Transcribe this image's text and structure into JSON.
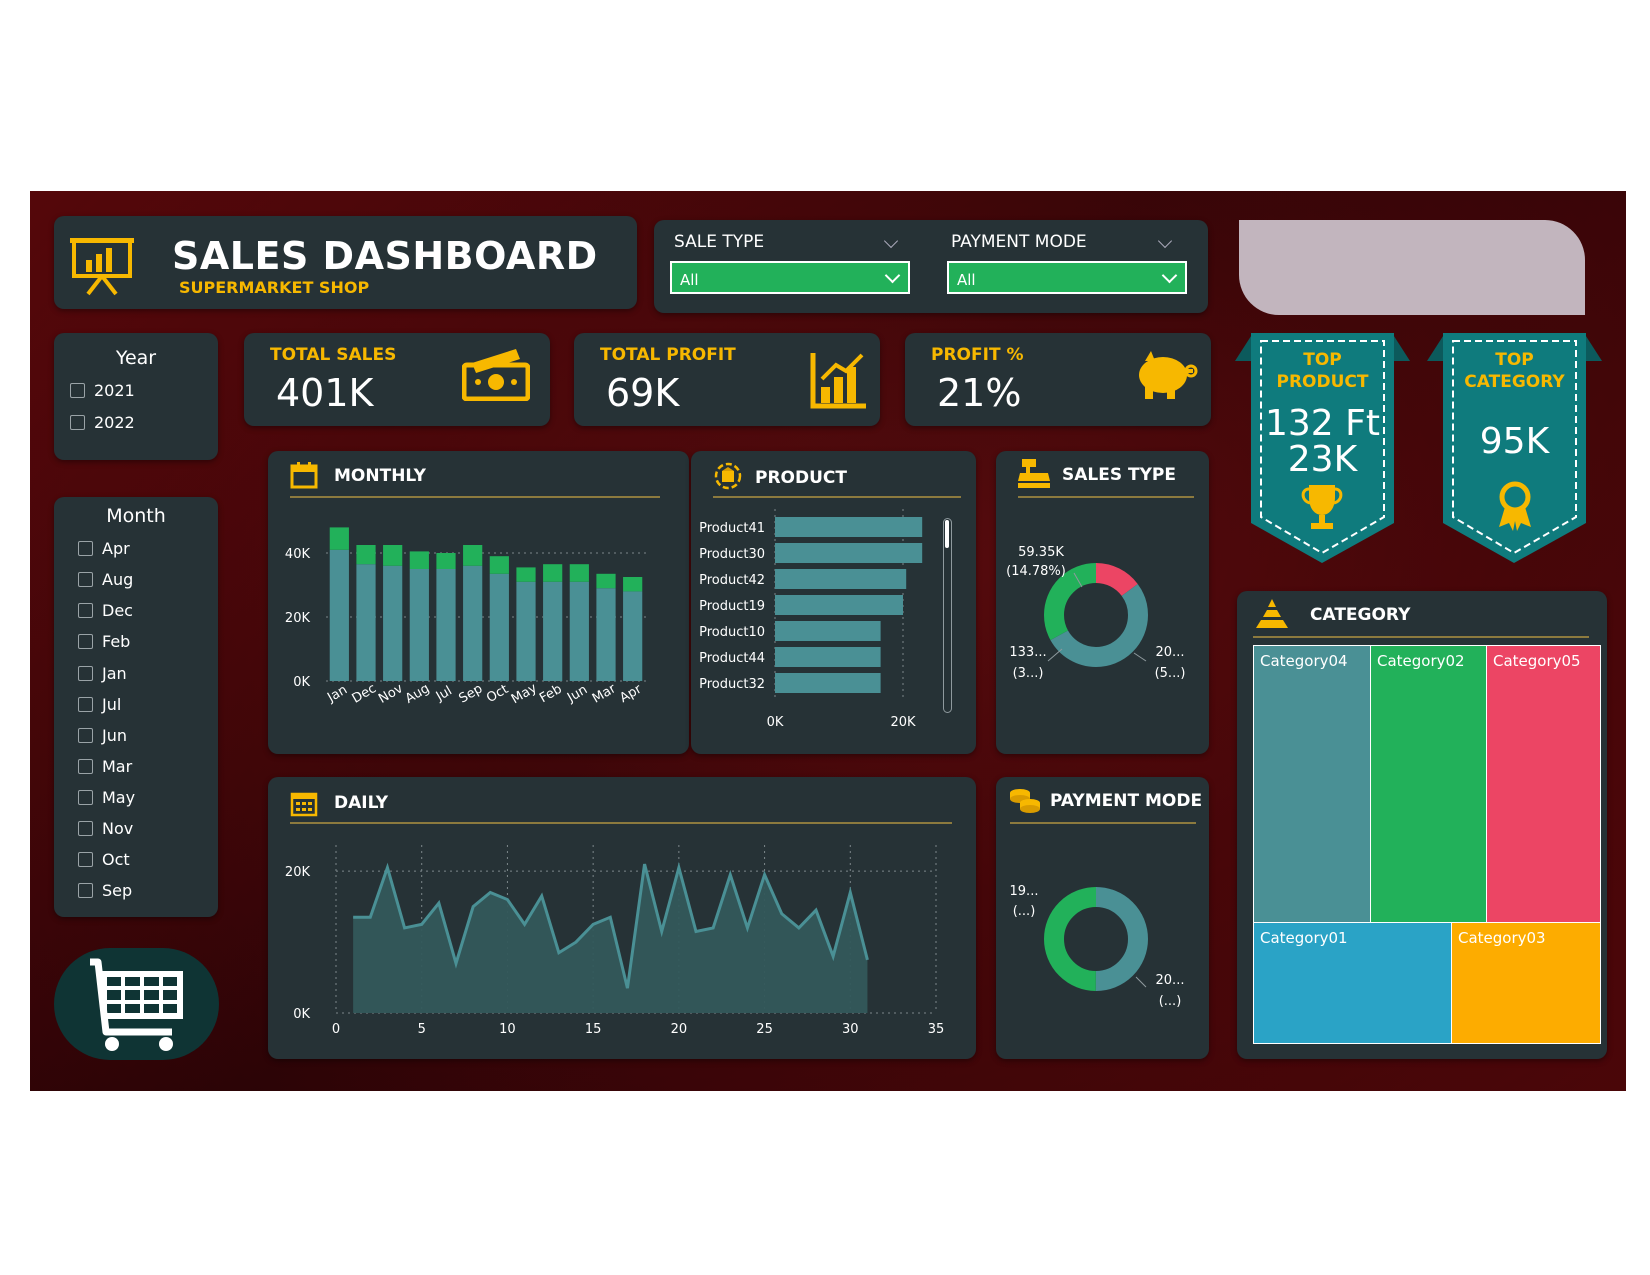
{
  "header": {
    "title": "SALES DASHBOARD",
    "subtitle": "SUPERMARKET SHOP"
  },
  "filters": {
    "sale_type": {
      "label": "SALE TYPE",
      "value": "All"
    },
    "payment_mode": {
      "label": "PAYMENT MODE",
      "value": "All"
    }
  },
  "year_slicer": {
    "title": "Year",
    "items": [
      "2021",
      "2022"
    ]
  },
  "month_slicer": {
    "title": "Month",
    "items": [
      "Apr",
      "Aug",
      "Dec",
      "Feb",
      "Jan",
      "Jul",
      "Jun",
      "Mar",
      "May",
      "Nov",
      "Oct",
      "Sep"
    ]
  },
  "kpis": {
    "total_sales": {
      "label": "TOTAL SALES",
      "value": "401K"
    },
    "total_profit": {
      "label": "TOTAL PROFIT",
      "value": "69K"
    },
    "profit_pct": {
      "label": "PROFIT %",
      "value": "21%"
    }
  },
  "top_product": {
    "line1": "TOP",
    "line2": "PRODUCT",
    "value1": "132 Ft",
    "value2": "23K"
  },
  "top_category": {
    "line1": "TOP",
    "line2": "CATEGORY",
    "value": "95K"
  },
  "sections": {
    "monthly": "MONTHLY",
    "product": "PRODUCT",
    "sales_type": "SALES TYPE",
    "daily": "DAILY",
    "payment_mode": "PAYMENT MODE",
    "category": "CATEGORY"
  },
  "colors": {
    "teal": "#4a9095",
    "green": "#22b15a",
    "red": "#ec4564",
    "blue": "#2aa3c6",
    "orange": "#fdac00",
    "yellow": "#f7b800"
  },
  "chart_data": [
    {
      "id": "monthly",
      "type": "bar",
      "categories": [
        "Jan",
        "Dec",
        "Nov",
        "Aug",
        "Jul",
        "Sep",
        "Oct",
        "May",
        "Feb",
        "Jun",
        "Mar",
        "Apr"
      ],
      "series": [
        {
          "values": [
            41000,
            36500,
            36000,
            35000,
            35000,
            36000,
            33500,
            31000,
            31000,
            31000,
            29000,
            28000
          ]
        },
        {
          "values": [
            7000,
            6000,
            6500,
            5500,
            5000,
            6500,
            5500,
            4500,
            5500,
            5500,
            4500,
            4500
          ]
        }
      ],
      "yticks": [
        "0K",
        "20K",
        "40K"
      ],
      "ylim": [
        0,
        50000
      ]
    },
    {
      "id": "product",
      "type": "bar",
      "orientation": "horizontal",
      "categories": [
        "Product41",
        "Product30",
        "Product42",
        "Product19",
        "Product10",
        "Product44",
        "Product32"
      ],
      "values": [
        23000,
        23000,
        20500,
        20000,
        16500,
        16500,
        16500
      ],
      "xticks": [
        "0K",
        "20K"
      ],
      "xlim": [
        0,
        25000
      ]
    },
    {
      "id": "sales_type",
      "type": "pie",
      "slices": [
        {
          "value": 59.35,
          "label": "59.35K",
          "pct": "(14.78%)"
        },
        {
          "value": 133,
          "label": "133...",
          "pct": "(3...)"
        },
        {
          "value": 209,
          "label": "20...",
          "pct": "(5...)"
        }
      ]
    },
    {
      "id": "daily",
      "type": "area",
      "x": [
        1,
        2,
        3,
        4,
        5,
        6,
        7,
        8,
        9,
        10,
        11,
        12,
        13,
        14,
        15,
        16,
        17,
        18,
        19,
        20,
        21,
        22,
        23,
        24,
        25,
        26,
        27,
        28,
        29,
        30,
        31
      ],
      "values": [
        13500,
        13500,
        20500,
        12000,
        12500,
        15500,
        7000,
        15000,
        17000,
        16000,
        12500,
        16500,
        8500,
        10000,
        12500,
        13500,
        3500,
        21000,
        11500,
        20500,
        11500,
        12000,
        19500,
        12000,
        19500,
        14000,
        12000,
        14500,
        8000,
        17000,
        7500
      ],
      "xticks": [
        "0",
        "5",
        "10",
        "15",
        "20",
        "25",
        "30",
        "35"
      ],
      "xlim": [
        0,
        35
      ],
      "yticks": [
        "0K",
        "20K"
      ],
      "ylim": [
        0,
        22000
      ]
    },
    {
      "id": "payment_mode",
      "type": "pie",
      "slices": [
        {
          "value": 50,
          "label": "19...",
          "pct": "(...)"
        },
        {
          "value": 50,
          "label": "20...",
          "pct": "(...)"
        }
      ]
    },
    {
      "id": "category",
      "type": "heatmap",
      "cells": [
        "Category04",
        "Category02",
        "Category05",
        "Category01",
        "Category03"
      ]
    }
  ]
}
